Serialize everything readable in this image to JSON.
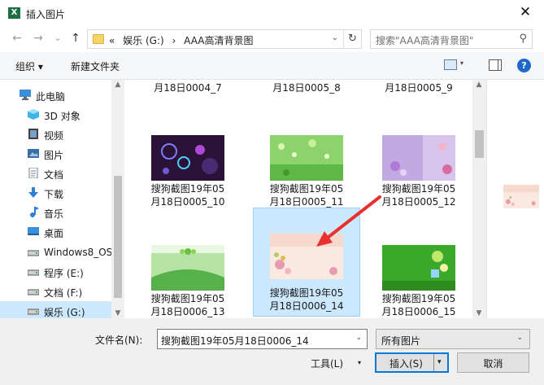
{
  "window": {
    "app_icon_letter": "X",
    "title": "插入图片",
    "close_glyph": "✕"
  },
  "nav": {
    "back_glyph": "←",
    "forward_glyph": "→",
    "recent_glyph": "⌄",
    "up_glyph": "↑",
    "address_prefix": "«",
    "breadcrumb": [
      "娱乐 (G:)",
      "›",
      "AAA高清背景图"
    ],
    "address_dropdown_glyph": "⌄",
    "refresh_glyph": "↻",
    "search_placeholder": "搜索\"AAA高清背景图\"",
    "search_glyph": "⚲"
  },
  "toolbar": {
    "organize_label": "组织 ▾",
    "new_folder_label": "新建文件夹",
    "view_dropdown_glyph": "▾",
    "help_glyph": "?"
  },
  "sidebar": {
    "items": [
      {
        "label": "此电脑",
        "icon": "computer-icon",
        "color": "#3b8fd9"
      },
      {
        "label": "3D 对象",
        "icon": "cube-3d-icon",
        "color": "#3fb4e8"
      },
      {
        "label": "视频",
        "icon": "video-icon",
        "color": "#404040"
      },
      {
        "label": "图片",
        "icon": "picture-icon",
        "color": "#3b6ea5"
      },
      {
        "label": "文档",
        "icon": "document-icon",
        "color": "#6b7c8f"
      },
      {
        "label": "下载",
        "icon": "download-icon",
        "color": "#2f7fd6"
      },
      {
        "label": "音乐",
        "icon": "music-icon",
        "color": "#2f7fd6"
      },
      {
        "label": "桌面",
        "icon": "desktop-icon",
        "color": "#3b8fd9"
      },
      {
        "label": "Windows8_OS",
        "icon": "drive-icon",
        "color": "#555555"
      },
      {
        "label": "程序 (E:)",
        "icon": "drive-icon",
        "color": "#555555"
      },
      {
        "label": "文档 (F:)",
        "icon": "drive-icon",
        "color": "#555555"
      },
      {
        "label": "娱乐 (G:)",
        "icon": "drive-icon",
        "color": "#555555"
      }
    ],
    "scroll_up_glyph": "▲",
    "scroll_down_glyph": "▼"
  },
  "files": {
    "top_partial": [
      "月18日0004_7",
      "月18日0005_8",
      "月18日0005_9"
    ],
    "items": [
      {
        "line1": "搜狗截图19年05",
        "line2": "月18日0005_10",
        "thumb": "purple-bubbles"
      },
      {
        "line1": "搜狗截图19年05",
        "line2": "月18日0005_11",
        "thumb": "green-bokeh"
      },
      {
        "line1": "搜狗截图19年05",
        "line2": "月18日0005_12",
        "thumb": "lavender-flowers"
      },
      {
        "line1": "搜狗截图19年05",
        "line2": "月18日0006_13",
        "thumb": "green-bow"
      },
      {
        "line1": "搜狗截图19年05",
        "line2": "月18日0006_14",
        "thumb": "pink-floral-birds"
      },
      {
        "line1": "搜狗截图19年05",
        "line2": "月18日0006_15",
        "thumb": "green-cartoon"
      }
    ],
    "selected_index": 4
  },
  "bottom": {
    "filename_label": "文件名(N):",
    "filename_value": "搜狗截图19年05月18日0006_14",
    "filename_dropdown_glyph": "⌄",
    "filetype_value": "所有图片",
    "filetype_dropdown_glyph": "⌄",
    "tools_label": "工具(L)",
    "tools_dropdown_glyph": "▾",
    "insert_label": "插入(S)",
    "insert_dropdown_glyph": "▾",
    "cancel_label": "取消"
  },
  "colors": {
    "selection_bg": "#cce8ff",
    "selection_border": "#99d1ff",
    "accent_border": "#0078d7",
    "annotation_arrow": "#e8312f"
  }
}
